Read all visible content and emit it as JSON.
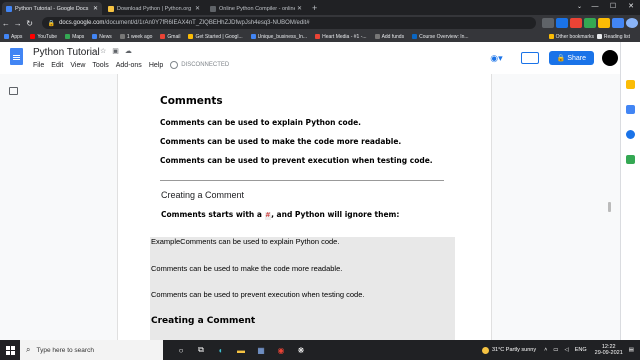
{
  "browser": {
    "tabs": [
      {
        "title": "Python Tutorial - Google Docs",
        "color": "#4285f4",
        "active": true
      },
      {
        "title": "Download Python | Python.org",
        "color": "#f6c342",
        "active": false
      },
      {
        "title": "Online Python Compiler - online",
        "color": "#5f6368",
        "active": false
      }
    ],
    "new_tab": "+",
    "url_host": "docs.google.com",
    "url_path": "/document/d/1rAn0Y7fR6IEAX4nT_ZlQBEHhZJDfwpJsh4esq3-NUBOM/edit#",
    "bookmarks": [
      {
        "label": "Apps",
        "color": "#4285f4"
      },
      {
        "label": "YouTube",
        "color": "#ff0000"
      },
      {
        "label": "Maps",
        "color": "#34a853"
      },
      {
        "label": "News",
        "color": "#4285f4"
      },
      {
        "label": "1 week ago",
        "color": "#555"
      },
      {
        "label": "Gmail",
        "color": "#ea4335"
      },
      {
        "label": "Get Started | Googl...",
        "color": "#fbbc05"
      },
      {
        "label": "Unique_business_In...",
        "color": "#4285f4"
      },
      {
        "label": "Heart Media - #1 -...",
        "color": "#ea4335"
      },
      {
        "label": "Add funds",
        "color": "#555"
      },
      {
        "label": "Course Overview: In...",
        "color": "#0a66c2"
      }
    ],
    "other_bookmarks": "Other bookmarks",
    "reading_list": "Reading list"
  },
  "docs": {
    "title": "Python Tutorial",
    "menu": [
      "File",
      "Edit",
      "View",
      "Tools",
      "Add-ons",
      "Help"
    ],
    "status": "DISCONNECTED",
    "share_label": "Share"
  },
  "document": {
    "heading": "Comments",
    "lines": [
      "Comments can be used to explain Python code.",
      "Comments can be used to make the code more readable.",
      "Comments can be used to prevent execution when testing code."
    ],
    "subheading": "Creating a Comment",
    "intro_pre": "Comments starts with a ",
    "intro_code": "#",
    "intro_post": ", and Python will ignore them:",
    "pasted_lines": [
      "ExampleComments can be used to explain Python code.",
      "Comments can be used to make the code more readable.",
      "Comments can be used to prevent execution when testing code."
    ],
    "pasted_heading": "Creating a Comment"
  },
  "taskbar": {
    "search_placeholder": "Type here to search",
    "weather": "31°C  Partly sunny",
    "language": "ENG",
    "time": "12:22",
    "date": "29-09-2021"
  }
}
